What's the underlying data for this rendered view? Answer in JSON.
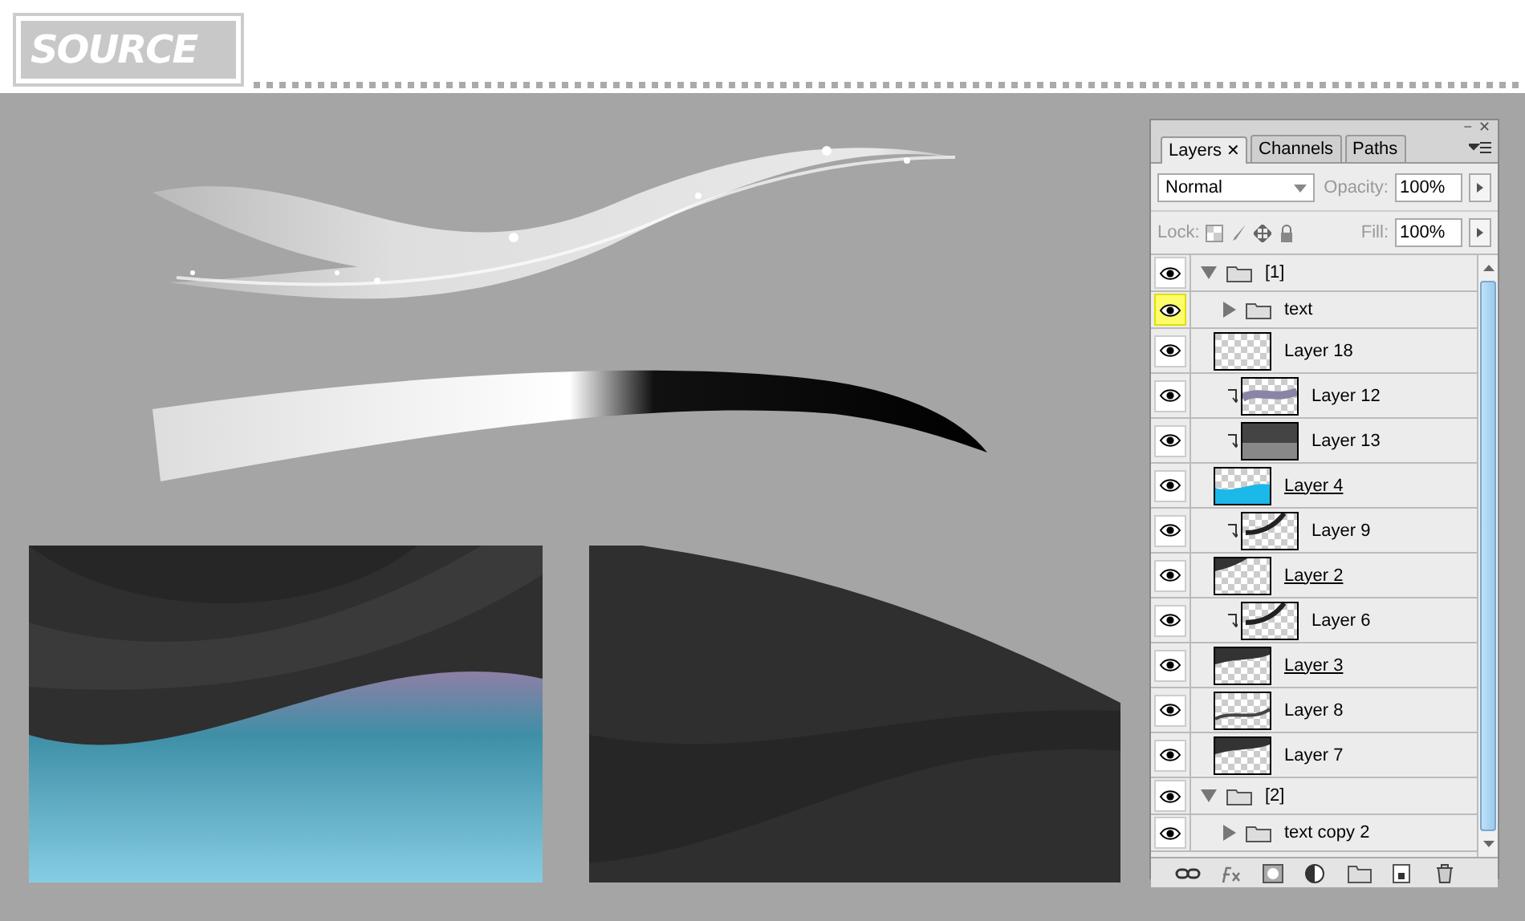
{
  "header": {
    "title": "SOURCE"
  },
  "layers_panel": {
    "window_controls": [
      "−",
      "✕"
    ],
    "tabs": [
      {
        "label": "Layers",
        "selected": true,
        "close": "✕"
      },
      {
        "label": "Channels",
        "selected": false
      },
      {
        "label": "Paths",
        "selected": false
      }
    ],
    "blend_mode": "Normal",
    "opacity_label": "Opacity:",
    "opacity": "100%",
    "lock_label": "Lock:",
    "fill_label": "Fill:",
    "fill": "100%",
    "layers": [
      {
        "kind": "group",
        "name": "[1]",
        "visible": true,
        "highlighted": false,
        "expanded": true,
        "children": [
          {
            "kind": "group",
            "name": "text",
            "visible": true,
            "highlighted": true,
            "expanded": false
          },
          {
            "kind": "layer",
            "name": "Layer 18",
            "visible": true,
            "highlighted": false,
            "clipped": false,
            "clip_base": false,
            "thumbnail": {
              "kind": "empty"
            }
          },
          {
            "kind": "layer",
            "name": "Layer 12",
            "visible": true,
            "highlighted": false,
            "clipped": true,
            "clip_base": false,
            "thumbnail": {
              "kind": "band"
            }
          },
          {
            "kind": "layer",
            "name": "Layer 13",
            "visible": true,
            "highlighted": false,
            "clipped": true,
            "clip_base": false,
            "thumbnail": {
              "kind": "gradient"
            }
          },
          {
            "kind": "layer",
            "name": "Layer 4",
            "visible": true,
            "highlighted": false,
            "clipped": false,
            "clip_base": true,
            "thumbnail": {
              "kind": "blue"
            }
          },
          {
            "kind": "layer",
            "name": "Layer 9",
            "visible": true,
            "highlighted": false,
            "clipped": true,
            "clip_base": false,
            "thumbnail": {
              "kind": "arc"
            }
          },
          {
            "kind": "layer",
            "name": "Layer 2",
            "visible": true,
            "highlighted": false,
            "clipped": false,
            "clip_base": true,
            "thumbnail": {
              "kind": "corner"
            }
          },
          {
            "kind": "layer",
            "name": "Layer 6",
            "visible": true,
            "highlighted": false,
            "clipped": true,
            "clip_base": false,
            "thumbnail": {
              "kind": "arc"
            }
          },
          {
            "kind": "layer",
            "name": "Layer 3",
            "visible": true,
            "highlighted": false,
            "clipped": false,
            "clip_base": true,
            "thumbnail": {
              "kind": "dark-wave"
            }
          },
          {
            "kind": "layer",
            "name": "Layer 8",
            "visible": true,
            "highlighted": false,
            "clipped": false,
            "clip_base": false,
            "thumbnail": {
              "kind": "wave"
            }
          },
          {
            "kind": "layer",
            "name": "Layer 7",
            "visible": true,
            "highlighted": false,
            "clipped": false,
            "clip_base": false,
            "thumbnail": {
              "kind": "dark-wave"
            }
          }
        ]
      },
      {
        "kind": "group",
        "name": "[2]",
        "visible": true,
        "highlighted": false,
        "expanded": true,
        "children": [
          {
            "kind": "group",
            "name": "text copy 2",
            "visible": true,
            "highlighted": false,
            "expanded": false
          }
        ]
      }
    ]
  }
}
